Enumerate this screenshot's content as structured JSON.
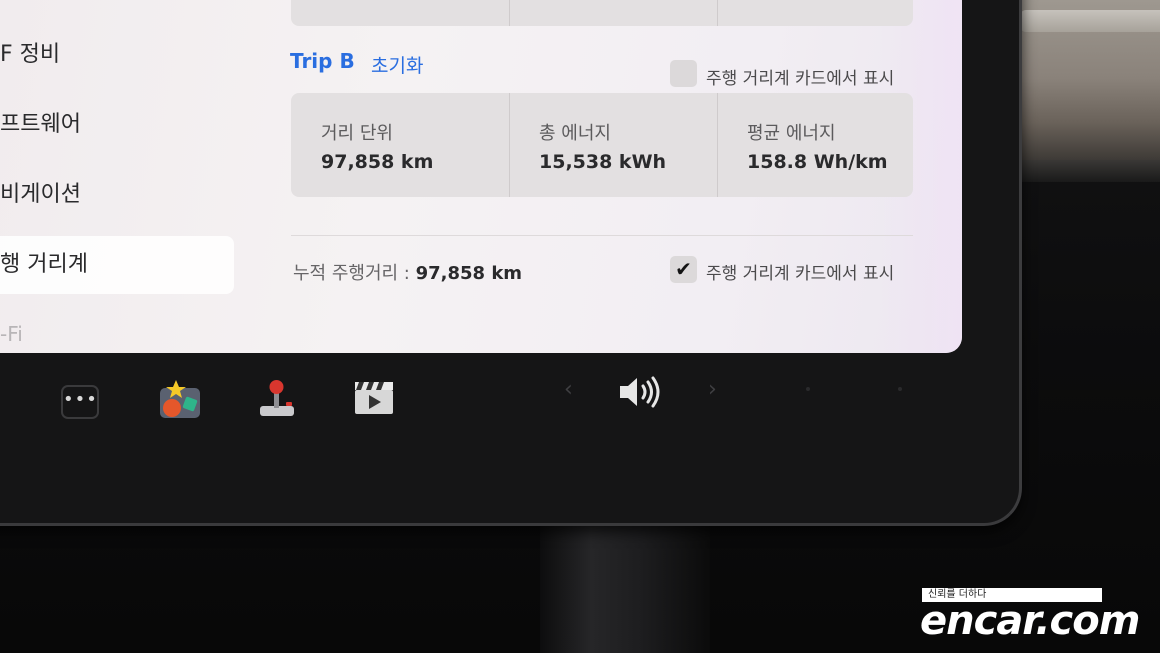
{
  "sidebar": {
    "items": [
      {
        "label": "F 정비"
      },
      {
        "label": "프트웨어"
      },
      {
        "label": "비게이션"
      },
      {
        "label": "행 거리계"
      },
      {
        "label": "-Fi"
      }
    ]
  },
  "trip_b": {
    "title": "Trip B",
    "reset_label": "초기화",
    "show_on_card_label": "주행 거리계 카드에서 표시",
    "show_on_card_checked": false,
    "stats": [
      {
        "label": "거리 단위",
        "value": "97,858 km"
      },
      {
        "label": "총 에너지",
        "value": "15,538 kWh"
      },
      {
        "label": "평균 에너지",
        "value": "158.8 Wh/km"
      }
    ]
  },
  "odometer": {
    "label": "누적 주행거리 :",
    "value": "97,858 km",
    "show_on_card_label": "주행 거리계 카드에서 표시",
    "show_on_card_checked": true,
    "check_glyph": "✔"
  },
  "dock": {
    "more_label": "•••",
    "icons": [
      "more-icon",
      "toybox-icon",
      "arcade-joystick-icon",
      "theater-icon",
      "volume-icon"
    ],
    "prev_arrow": "‹",
    "next_arrow": "›"
  },
  "watermark": {
    "tagline": "신뢰를 더하다",
    "logo": "encar.com"
  },
  "colors": {
    "accent_blue": "#2a6ee0",
    "screen_bg": "#f3eff2",
    "card_bg": "#e3e0e1"
  }
}
